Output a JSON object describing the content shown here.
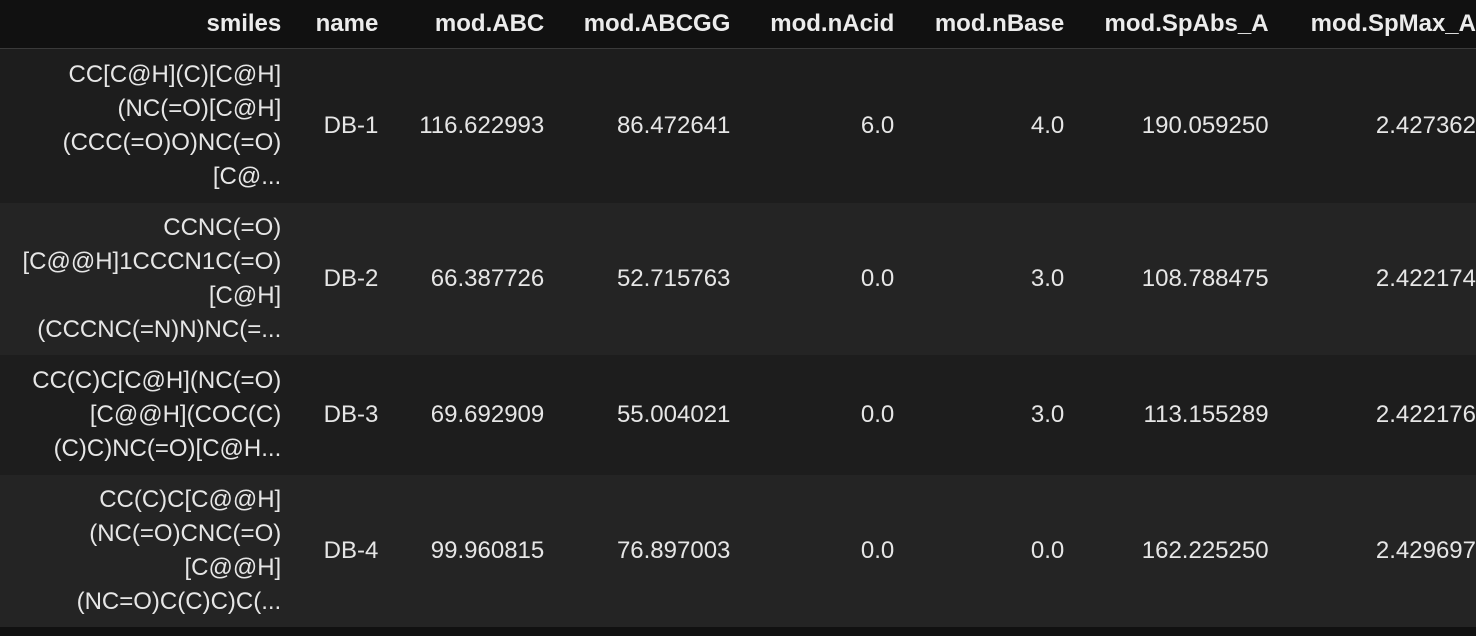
{
  "table": {
    "columns": [
      "smiles",
      "name",
      "mod.ABC",
      "mod.ABCGG",
      "mod.nAcid",
      "mod.nBase",
      "mod.SpAbs_A",
      "mod.SpMax_A"
    ],
    "rows": [
      {
        "smiles_lines": [
          "CC[C@H](C)[C@H]",
          "(NC(=O)[C@H]",
          "(CCC(=O)O)NC(=O)",
          "[C@..."
        ],
        "name": "DB-1",
        "mod_ABC": "116.622993",
        "mod_ABCGG": "86.472641",
        "mod_nAcid": "6.0",
        "mod_nBase": "4.0",
        "mod_SpAbs_A": "190.059250",
        "mod_SpMax_A": "2.427362"
      },
      {
        "smiles_lines": [
          "CCNC(=O)",
          "[C@@H]1CCCN1C(=O)",
          "[C@H]",
          "(CCCNC(=N)N)NC(=..."
        ],
        "name": "DB-2",
        "mod_ABC": "66.387726",
        "mod_ABCGG": "52.715763",
        "mod_nAcid": "0.0",
        "mod_nBase": "3.0",
        "mod_SpAbs_A": "108.788475",
        "mod_SpMax_A": "2.422174"
      },
      {
        "smiles_lines": [
          "CC(C)C[C@H](NC(=O)",
          "[C@@H](COC(C)",
          "(C)C)NC(=O)[C@H..."
        ],
        "name": "DB-3",
        "mod_ABC": "69.692909",
        "mod_ABCGG": "55.004021",
        "mod_nAcid": "0.0",
        "mod_nBase": "3.0",
        "mod_SpAbs_A": "113.155289",
        "mod_SpMax_A": "2.422176"
      },
      {
        "smiles_lines": [
          "CC(C)C[C@@H]",
          "(NC(=O)CNC(=O)",
          "[C@@H]",
          "(NC=O)C(C)C)C(..."
        ],
        "name": "DB-4",
        "mod_ABC": "99.960815",
        "mod_ABCGG": "76.897003",
        "mod_nAcid": "0.0",
        "mod_nBase": "0.0",
        "mod_SpAbs_A": "162.225250",
        "mod_SpMax_A": "2.429697"
      }
    ]
  }
}
